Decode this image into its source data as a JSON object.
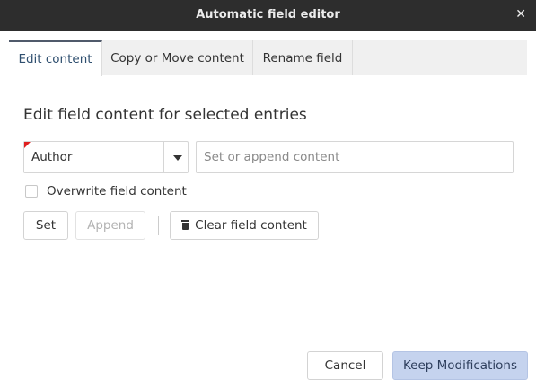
{
  "window": {
    "title": "Automatic field editor",
    "close_icon": "close-icon"
  },
  "tabs": [
    {
      "label": "Edit content",
      "active": true
    },
    {
      "label": "Copy or Move content",
      "active": false
    },
    {
      "label": "Rename field",
      "active": false
    }
  ],
  "edit": {
    "heading": "Edit field content for selected entries",
    "field_select": {
      "value": "Author"
    },
    "content_input": {
      "value": "",
      "placeholder": "Set or append content"
    },
    "overwrite": {
      "label": "Overwrite field content",
      "checked": false
    },
    "set_label": "Set",
    "append_label": "Append",
    "append_disabled": true,
    "clear_label": "Clear field content",
    "clear_icon": "trash-icon"
  },
  "footer": {
    "cancel_label": "Cancel",
    "keep_label": "Keep Modifications"
  },
  "colors": {
    "titlebar": "#2d2d2d",
    "active_tab_indicator": "#505a6b",
    "primary_button": "#c5d3ee",
    "required_marker": "#e02020"
  }
}
